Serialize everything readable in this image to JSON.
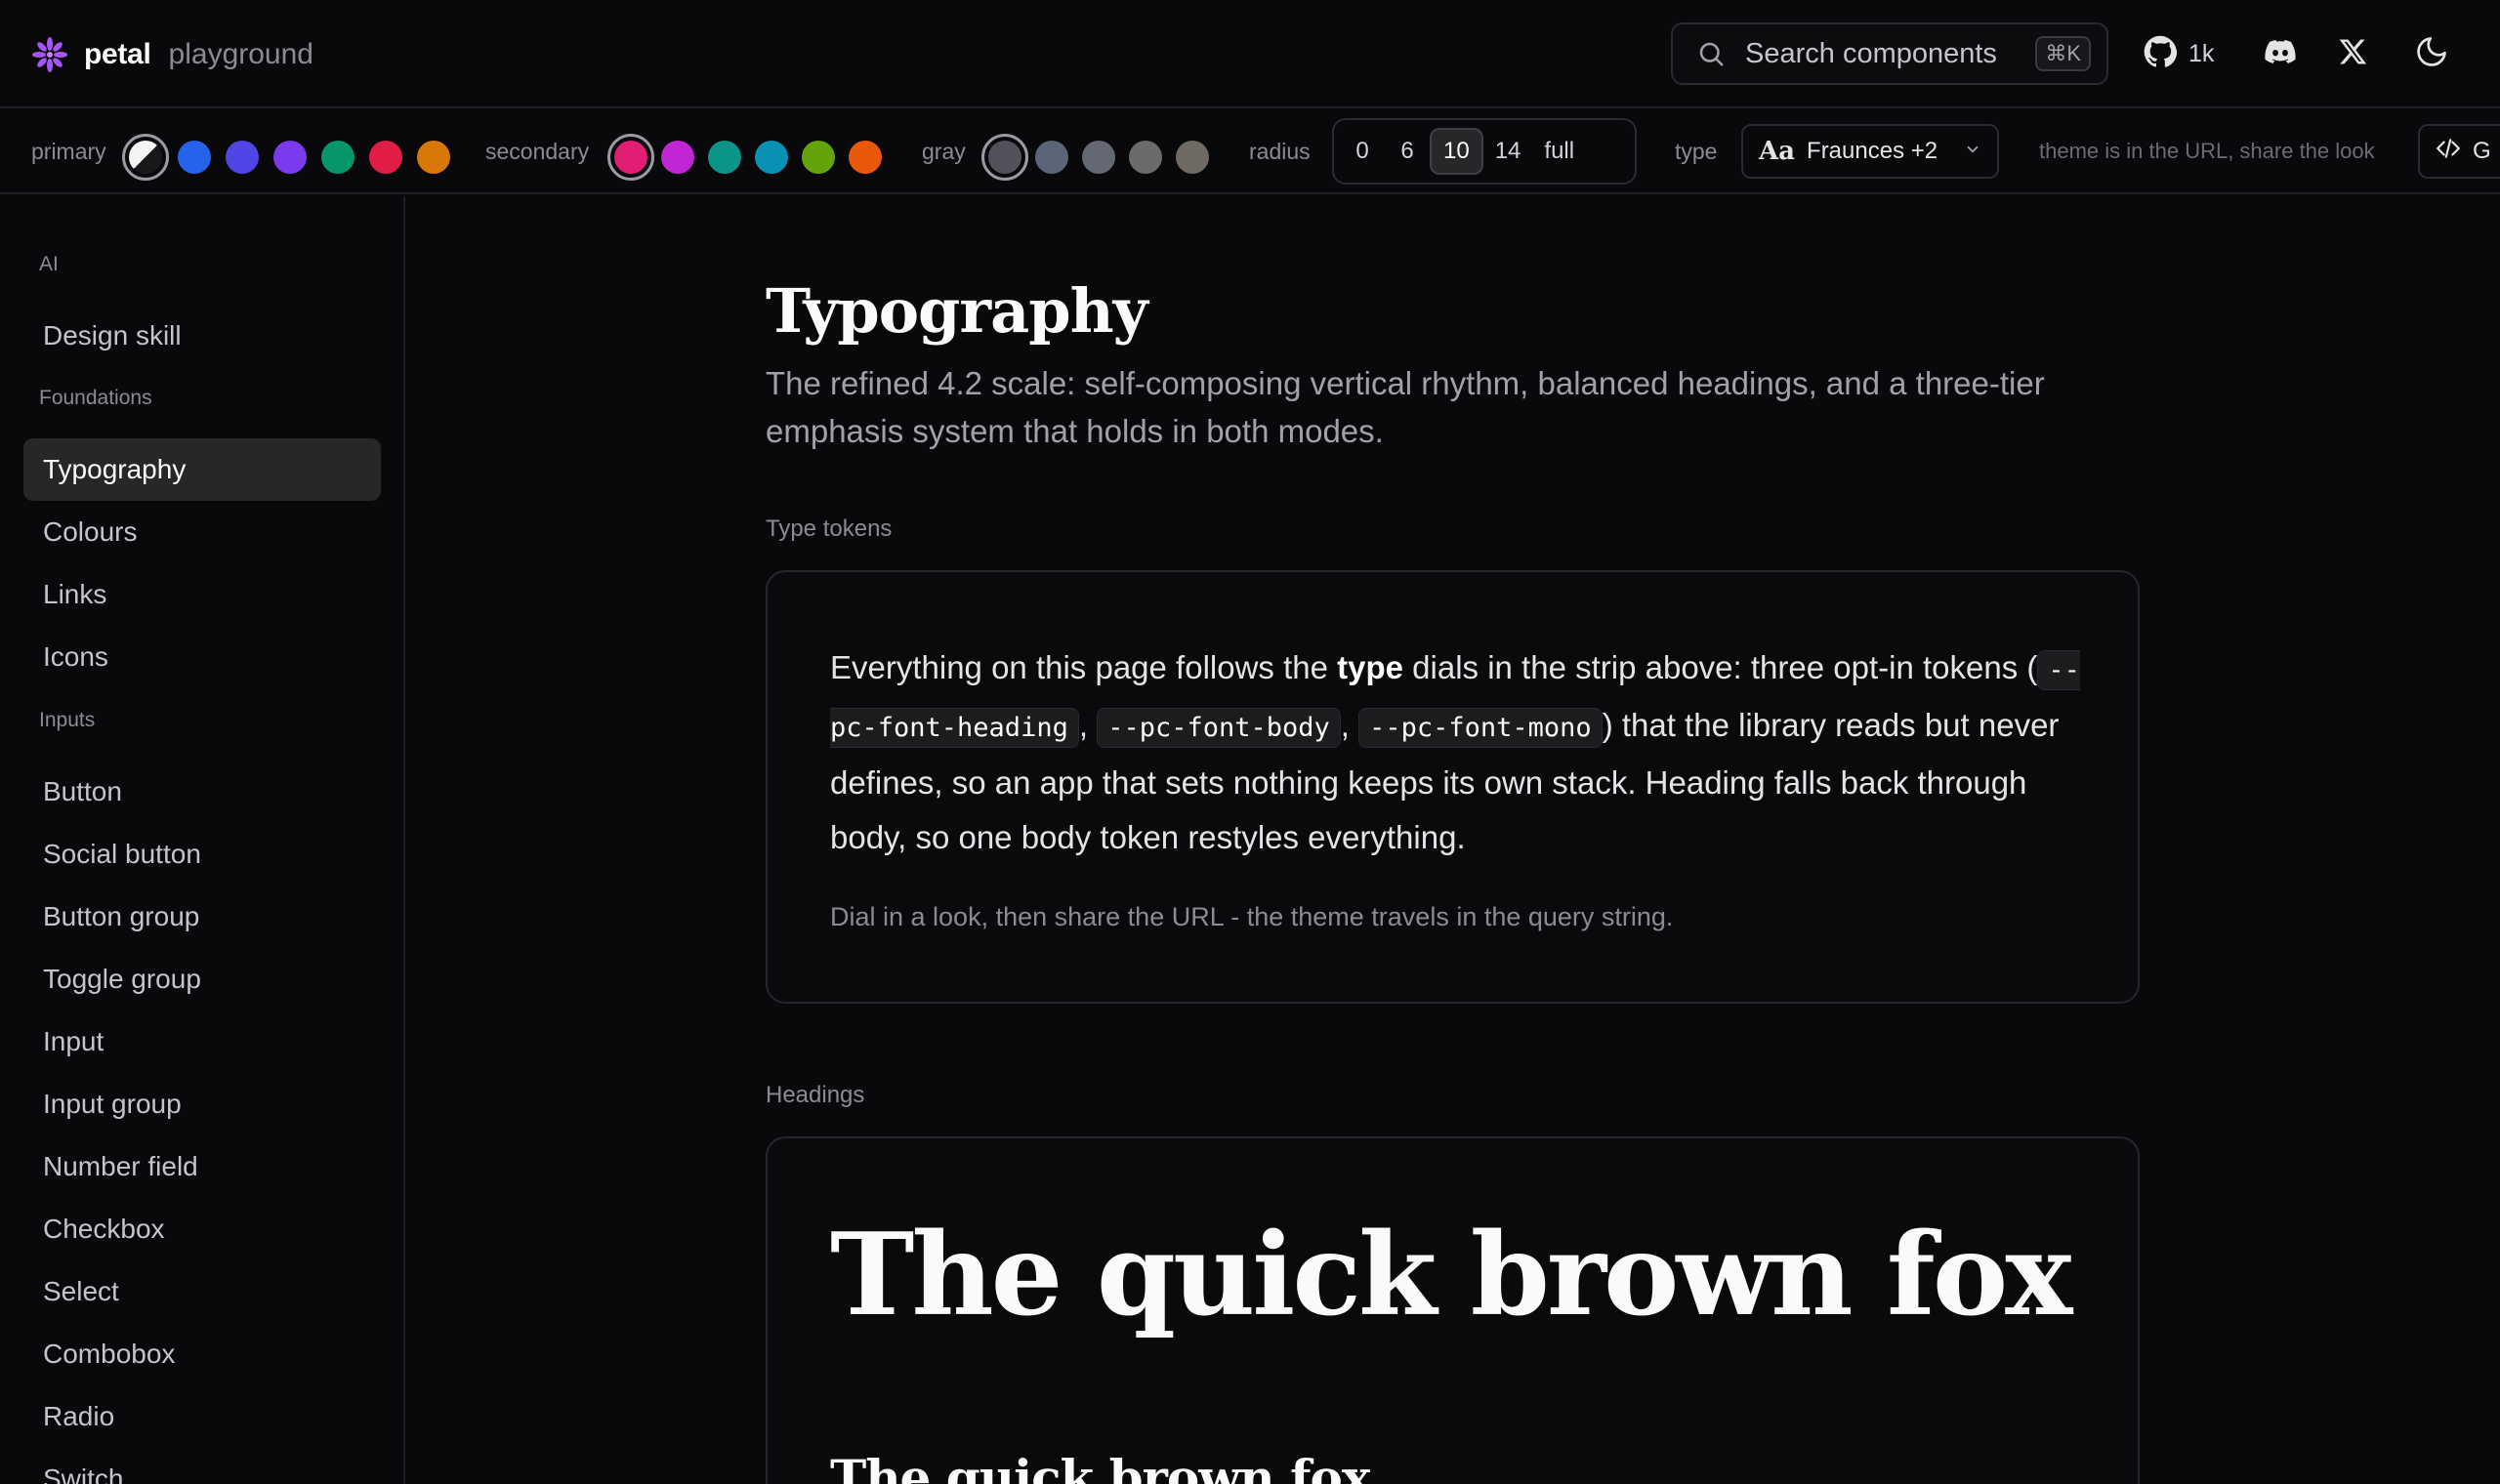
{
  "brand": {
    "name": "petal",
    "sub": "playground"
  },
  "search": {
    "placeholder": "Search components",
    "shortcut": "⌘K"
  },
  "header": {
    "github_count": "1k",
    "icons": [
      "github-icon",
      "discord-icon",
      "x-icon",
      "moon-icon"
    ]
  },
  "strip": {
    "primary_label": "primary",
    "primary_swatches": [
      "#2563eb",
      "#4f46e5",
      "#7c3aed",
      "#059669",
      "#e11d48",
      "#d97706"
    ],
    "secondary_label": "secondary",
    "secondary_swatches": [
      "#e11d74",
      "#c026d3",
      "#0d9488",
      "#0891b2",
      "#65a30d",
      "#ea580c"
    ],
    "gray_label": "gray",
    "gray_swatches": [
      "#52525b",
      "#5b6578",
      "#636872",
      "#6b6b6b",
      "#6f6a64"
    ],
    "radius_label": "radius",
    "radius_options": [
      "0",
      "6",
      "10",
      "14",
      "full"
    ],
    "radius_selected": "10",
    "type_label": "type",
    "type_value": "Fraunces +2",
    "type_aa": "Aa",
    "hint": "theme is in the URL, share the look",
    "code_button": "G"
  },
  "sidebar": {
    "sections": [
      {
        "label": "AI",
        "items": [
          "Design skill"
        ]
      },
      {
        "label": "Foundations",
        "items": [
          "Typography",
          "Colours",
          "Links",
          "Icons"
        ]
      },
      {
        "label": "Inputs",
        "items": [
          "Button",
          "Social button",
          "Button group",
          "Toggle group",
          "Input",
          "Input group",
          "Number field",
          "Checkbox",
          "Select",
          "Combobox",
          "Radio",
          "Switch"
        ]
      }
    ],
    "active": "Typography"
  },
  "main": {
    "title": "Typography",
    "subtitle": "The refined 4.2 scale: self-composing vertical rhythm, balanced headings, and a three-tier emphasis system that holds in both modes.",
    "tokens_label": "Type tokens",
    "tokens_para": {
      "p1": "Everything on this page follows the ",
      "bold": "type",
      "p2": " dials in the strip above: three opt-in tokens (",
      "code1": "--pc-font-heading",
      "sep1": ", ",
      "code2": "--pc-font-body",
      "sep2": ", ",
      "code3": "--pc-font-mono",
      "p3": ") that the library reads but never defines, so an app that sets nothing keeps its own stack. Heading falls back through body, so one body token restyles everything."
    },
    "tokens_note": "Dial in a look, then share the URL - the theme travels in the query string.",
    "headings_label": "Headings",
    "heading_sample_1": "The quick brown fox",
    "heading_sample_2": "The quick brown fox"
  }
}
